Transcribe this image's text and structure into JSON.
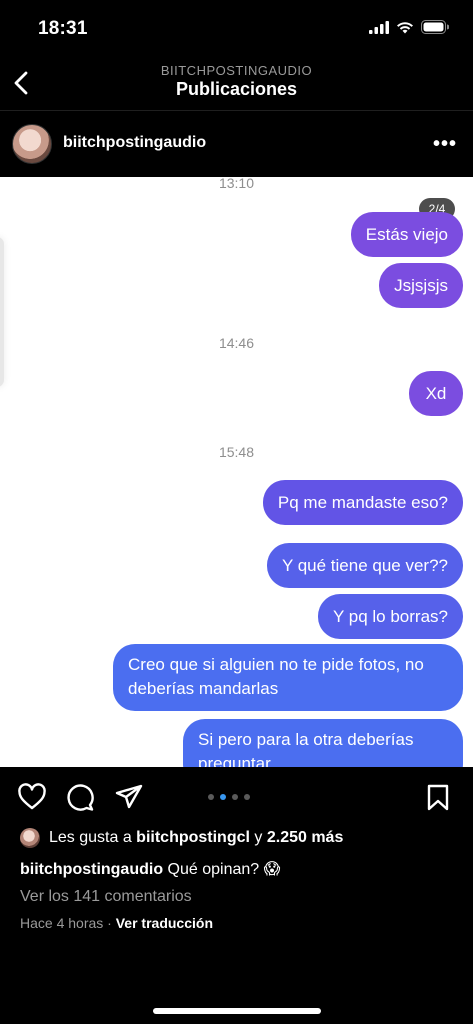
{
  "status": {
    "time": "18:31"
  },
  "header": {
    "account": "BIITCHPOSTINGAUDIO",
    "title": "Publicaciones"
  },
  "post": {
    "username": "biitchpostingaudio",
    "more_icon": "more-horizontal-icon"
  },
  "image": {
    "counter": "2/4",
    "messages": {
      "ts1": "13:10",
      "m1": "Estás viejo",
      "m2": "Jsjsjsjs",
      "ts2": "14:46",
      "m3": "Xd",
      "ts3": "15:48",
      "m4": "Pq me mandaste eso?",
      "m5": "Y qué tiene que ver??",
      "m6": "Y pq lo borras?",
      "m7": "Creo que si alguien no te pide fotos, no deberías mandarlas",
      "m8": "Si pero para la otra deberías preguntar"
    }
  },
  "actions": {
    "icons": [
      "heart-icon",
      "comment-icon",
      "share-icon",
      "bookmark-icon"
    ],
    "carousel_total": 4,
    "carousel_active": 2
  },
  "likes": {
    "prefix": "Les gusta a ",
    "user": "biitchpostingcl",
    "middle": " y ",
    "count": "2.250 más"
  },
  "caption": {
    "user": "biitchpostingaudio",
    "text": " Qué opinan? 😱"
  },
  "comments": "Ver los 141 comentarios",
  "meta": {
    "time": "Hace 4 horas",
    "sep": " · ",
    "translate": "Ver traducción"
  },
  "colors": {
    "bubble_purple": "#7b4de0",
    "bubble_blue": "#4b6ef0",
    "active_dot": "#3897f0"
  }
}
